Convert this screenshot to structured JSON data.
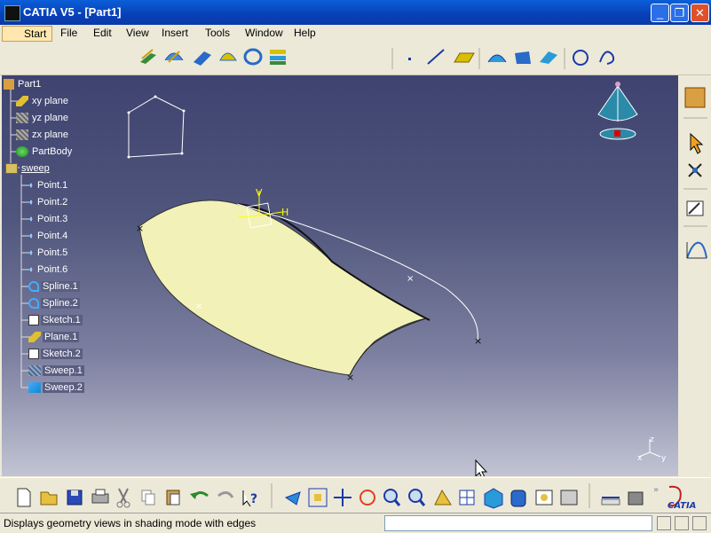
{
  "window": {
    "title": "CATIA V5 - [Part1]"
  },
  "menu": {
    "items": [
      "Start",
      "File",
      "Edit",
      "View",
      "Insert",
      "Tools",
      "Window",
      "Help"
    ],
    "underline": [
      "S",
      "F",
      "E",
      "V",
      "I",
      "T",
      "W",
      "H"
    ]
  },
  "tree": {
    "root": "Part1",
    "nodes": [
      {
        "label": "xy plane",
        "icon": "plane-icon"
      },
      {
        "label": "yz plane",
        "icon": "plane-icon"
      },
      {
        "label": "zx plane",
        "icon": "plane-icon"
      },
      {
        "label": "PartBody",
        "icon": "partbody-icon"
      },
      {
        "label": "sweep",
        "icon": "geometrical-set-icon"
      },
      {
        "label": "Point.1",
        "icon": "point-icon"
      },
      {
        "label": "Point.2",
        "icon": "point-icon"
      },
      {
        "label": "Point.3",
        "icon": "point-icon"
      },
      {
        "label": "Point.4",
        "icon": "point-icon"
      },
      {
        "label": "Point.5",
        "icon": "point-icon"
      },
      {
        "label": "Point.6",
        "icon": "point-icon"
      },
      {
        "label": "Spline.1",
        "icon": "spline-icon"
      },
      {
        "label": "Spline.2",
        "icon": "spline-icon"
      },
      {
        "label": "Sketch.1",
        "icon": "sketch-icon"
      },
      {
        "label": "Plane.1",
        "icon": "plane-icon"
      },
      {
        "label": "Sketch.2",
        "icon": "sketch-icon"
      },
      {
        "label": "Sweep.1",
        "icon": "sweep-icon"
      },
      {
        "label": "Sweep.2",
        "icon": "sweep-icon"
      }
    ]
  },
  "axes": {
    "compass_h": "H",
    "compass_v": "V",
    "triad_x": "x",
    "triad_y": "y",
    "triad_z": "z"
  },
  "logo": {
    "text": "CATIA"
  },
  "status": {
    "message": "Displays geometry views in shading mode with edges"
  },
  "colors": {
    "surface": "#f2f2b8",
    "title_bar": "#0a5fd8",
    "viewport_top": "#3f4370",
    "viewport_bottom": "#c2c4d4"
  }
}
